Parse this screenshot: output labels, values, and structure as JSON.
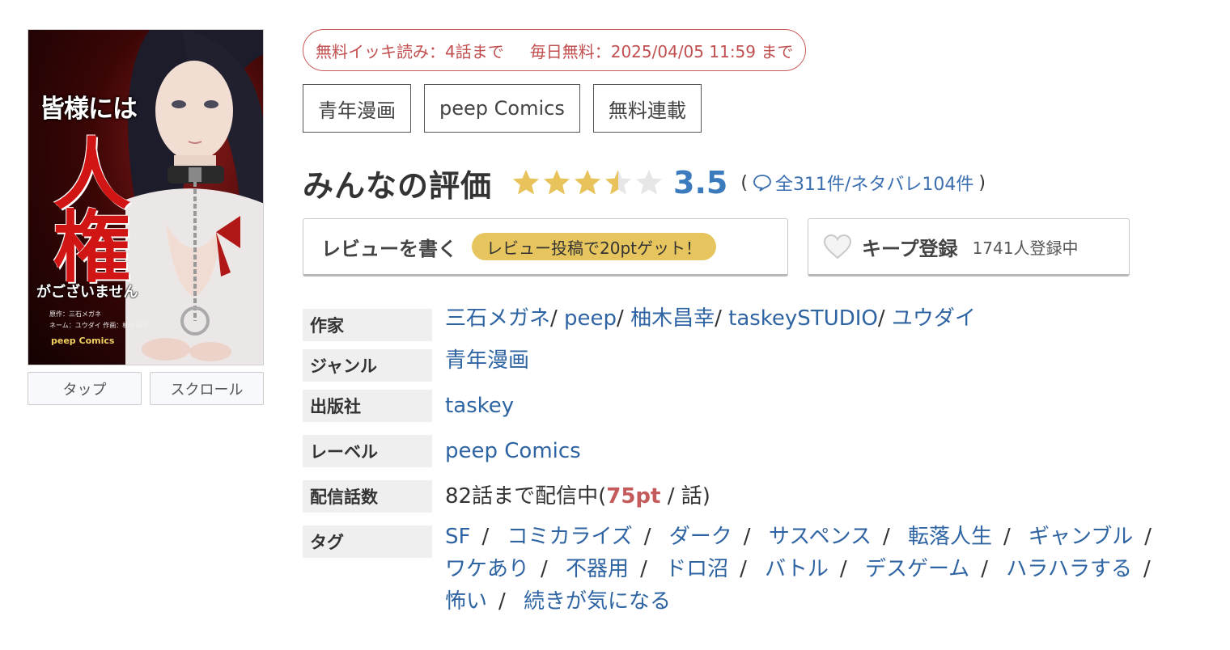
{
  "cover": {
    "title_small": "皆様には",
    "title_big": "人権",
    "title_sub": "がございません",
    "credit_lines": [
      "原作：三石メガネ",
      "ネーム：ユウダイ 作画：柚木昌幸"
    ],
    "label": "peep Comics"
  },
  "view_buttons": [
    "タップ",
    "スクロール"
  ],
  "free_info": {
    "ikki": "無料イッキ読み：4話まで",
    "daily": "毎日無料：2025/04/05 11:59 まで"
  },
  "top_tags": [
    "青年漫画",
    "peep Comics",
    "無料連載"
  ],
  "rating": {
    "title": "みんなの評価",
    "value": "3.5",
    "stars_filled": 3.5,
    "stars_max": 5,
    "open_paren": "(",
    "count_text": "全311件/ネタバレ104件",
    "close_paren": ")",
    "star_color": "#e8c35c",
    "star_empty_color": "#e6e6e6"
  },
  "review_button": {
    "label": "レビューを書く",
    "promo": "レビュー投稿で20ptゲット！"
  },
  "keep_button": {
    "label": "キープ登録",
    "count": "1741人登録中"
  },
  "info": {
    "author": {
      "key": "作家",
      "values": [
        "三石メガネ",
        "peep",
        "柚木昌幸",
        "taskeySTUDIO",
        "ユウダイ"
      ]
    },
    "genre": {
      "key": "ジャンル",
      "value": "青年漫画"
    },
    "publisher": {
      "key": "出版社",
      "value": "taskey"
    },
    "label": {
      "key": "レーベル",
      "value": "peep Comics"
    },
    "episodes": {
      "key": "配信話数",
      "prefix": "82話まで配信中(",
      "price": "75pt",
      "suffix": " / 話)"
    },
    "tags": {
      "key": "タグ",
      "values": [
        "SF",
        "コミカライズ",
        "ダーク",
        "サスペンス",
        "転落人生",
        "ギャンブル",
        "ワケあり",
        "不器用",
        "ドロ沼",
        "バトル",
        "デスゲーム",
        "ハラハラする",
        "怖い",
        "続きが気になる"
      ]
    }
  }
}
